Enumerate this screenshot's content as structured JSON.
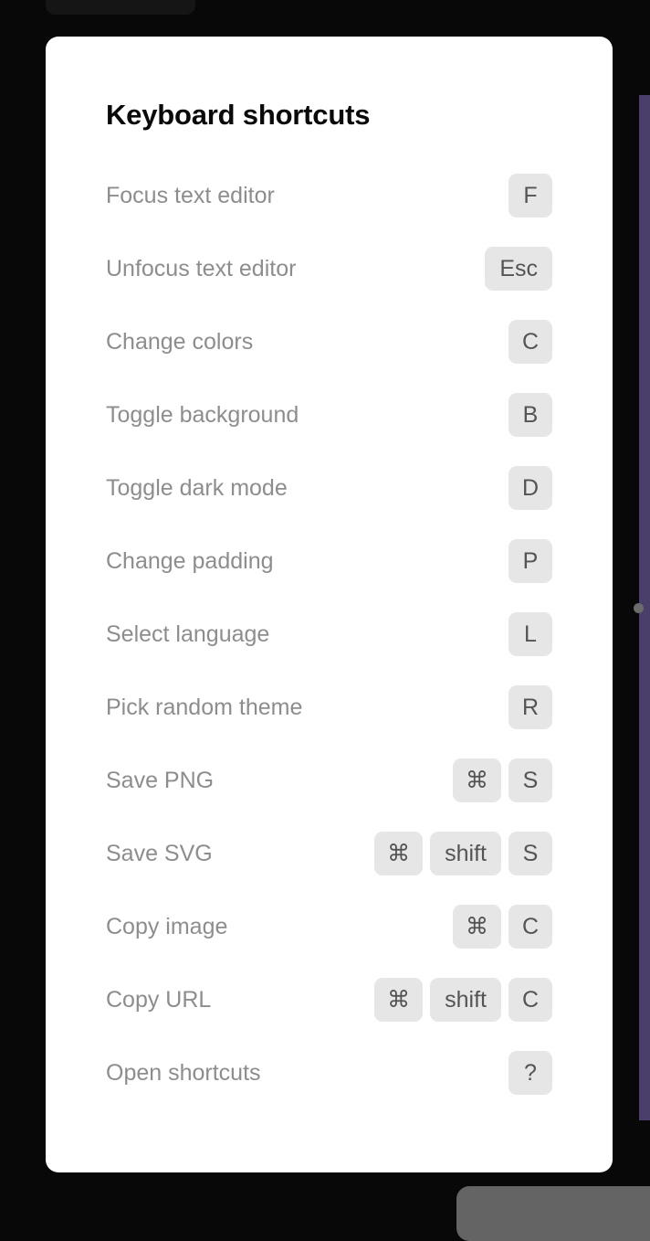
{
  "dialog": {
    "title": "Keyboard shortcuts",
    "shortcuts": [
      {
        "label": "Focus text editor",
        "keys": [
          "F"
        ]
      },
      {
        "label": "Unfocus text editor",
        "keys": [
          "Esc"
        ]
      },
      {
        "label": "Change colors",
        "keys": [
          "C"
        ]
      },
      {
        "label": "Toggle background",
        "keys": [
          "B"
        ]
      },
      {
        "label": "Toggle dark mode",
        "keys": [
          "D"
        ]
      },
      {
        "label": "Change padding",
        "keys": [
          "P"
        ]
      },
      {
        "label": "Select language",
        "keys": [
          "L"
        ]
      },
      {
        "label": "Pick random theme",
        "keys": [
          "R"
        ]
      },
      {
        "label": "Save PNG",
        "keys": [
          "⌘",
          "S"
        ]
      },
      {
        "label": "Save SVG",
        "keys": [
          "⌘",
          "shift",
          "S"
        ]
      },
      {
        "label": "Copy image",
        "keys": [
          "⌘",
          "C"
        ]
      },
      {
        "label": "Copy URL",
        "keys": [
          "⌘",
          "shift",
          "C"
        ]
      },
      {
        "label": "Open shortcuts",
        "keys": [
          "?"
        ]
      }
    ]
  },
  "colors": {
    "backdrop": "#080808",
    "accent_strip": "#4a3f6b",
    "key_bg": "#e6e6e6"
  }
}
